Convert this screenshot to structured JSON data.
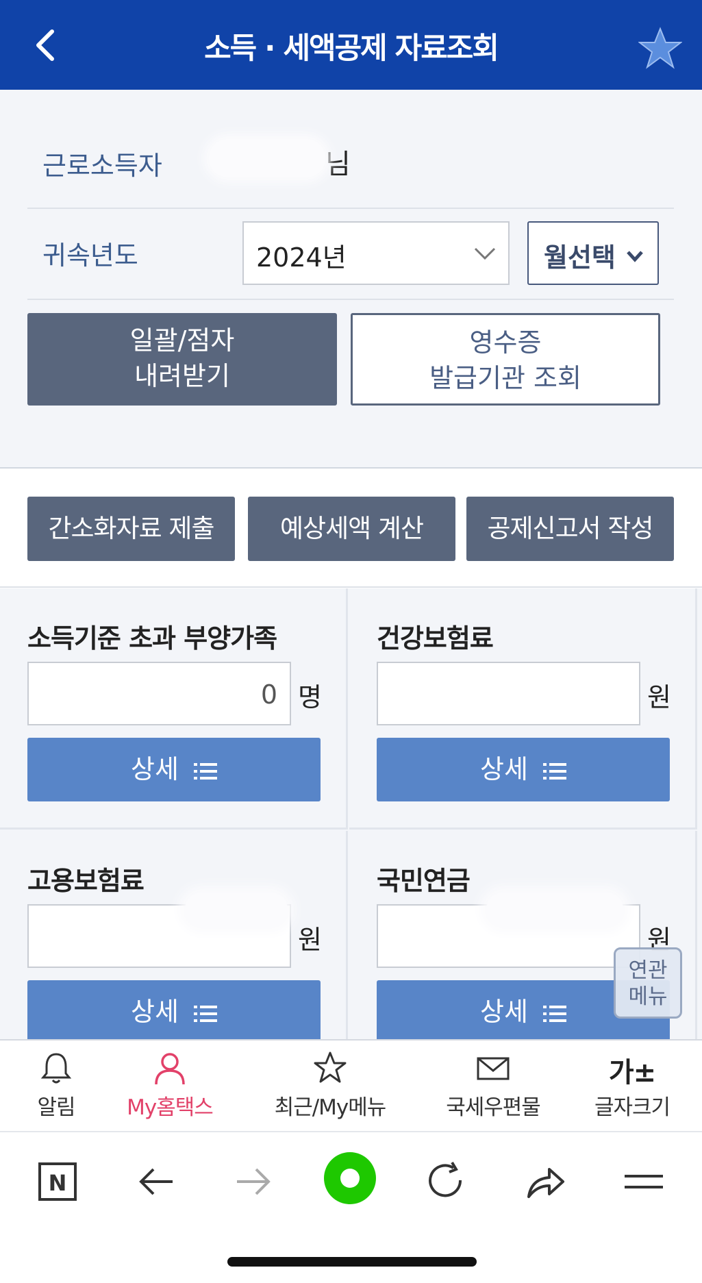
{
  "header": {
    "title": "소득 · 세액공제 자료조회"
  },
  "summary": {
    "earner_label": "근로소득자",
    "earner_name_suffix": "님",
    "year_label": "귀속년도",
    "year_value": "2024년",
    "month_select": "월선택",
    "download_button": "일괄/점자\n내려받기",
    "receipt_button": "영수증\n발급기관 조회"
  },
  "tools": {
    "simplified_submit": "간소화자료 제출",
    "estimated_tax": "예상세액 계산",
    "deduction_report": "공제신고서 작성"
  },
  "items": [
    {
      "title": "소득기준 초과 부양가족",
      "value": "0",
      "unit": "명",
      "detail": "상세"
    },
    {
      "title": "건강보험료",
      "value": "",
      "unit": "원",
      "detail": "상세"
    },
    {
      "title": "고용보험료",
      "value": "",
      "unit": "원",
      "detail": "상세"
    },
    {
      "title": "국민연금",
      "value": "",
      "unit": "원",
      "detail": "상세"
    }
  ],
  "related_menu": "연관\n메뉴",
  "bottom_nav": [
    {
      "label": "알림",
      "icon": "bell-icon"
    },
    {
      "label": "My홈택스",
      "icon": "person-icon"
    },
    {
      "label": "최근/My메뉴",
      "icon": "star-icon"
    },
    {
      "label": "국세우편물",
      "icon": "mail-icon"
    },
    {
      "label": "글자크기",
      "icon": "font-size-icon",
      "glyph": "가±"
    }
  ],
  "colors": {
    "header": "#1043a8",
    "dark_button": "#59667d",
    "detail_button": "#5885c8",
    "active_nav": "#e24169",
    "naver_green": "#1ec800"
  }
}
